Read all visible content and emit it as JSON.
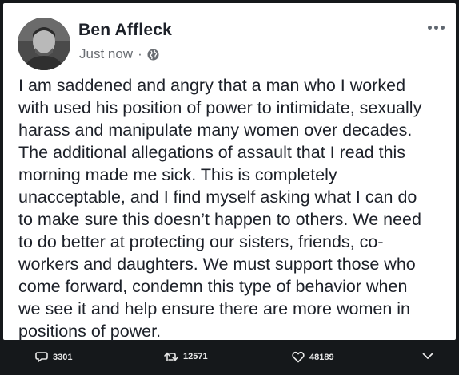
{
  "post": {
    "author": "Ben Affleck",
    "timestamp": "Just now",
    "separator": "·",
    "privacy_icon": "globe-icon",
    "body_lines": [
      "I am saddened and angry that a man who I worked",
      "with used his position of power to intimidate, sexually",
      "harass and manipulate many women over decades.",
      "The additional allegations of assault that I read this",
      "morning made me sick. This is completely",
      "unacceptable, and I find myself asking what I can do",
      "to make sure this doesn’t happen to others. We need",
      "to do better at protecting our sisters, friends, co-",
      "workers and daughters. We must support those who",
      "come forward, condemn this type of behavior when",
      "we see it and help ensure there are more women in",
      "positions of power."
    ]
  },
  "tweet_actions": {
    "replies": "3301",
    "retweets": "12571",
    "likes": "48189"
  },
  "icons": {
    "reply": "reply-icon",
    "retweet": "retweet-icon",
    "like": "heart-icon",
    "more": "chevron-down-icon",
    "options": "more-options-icon"
  }
}
